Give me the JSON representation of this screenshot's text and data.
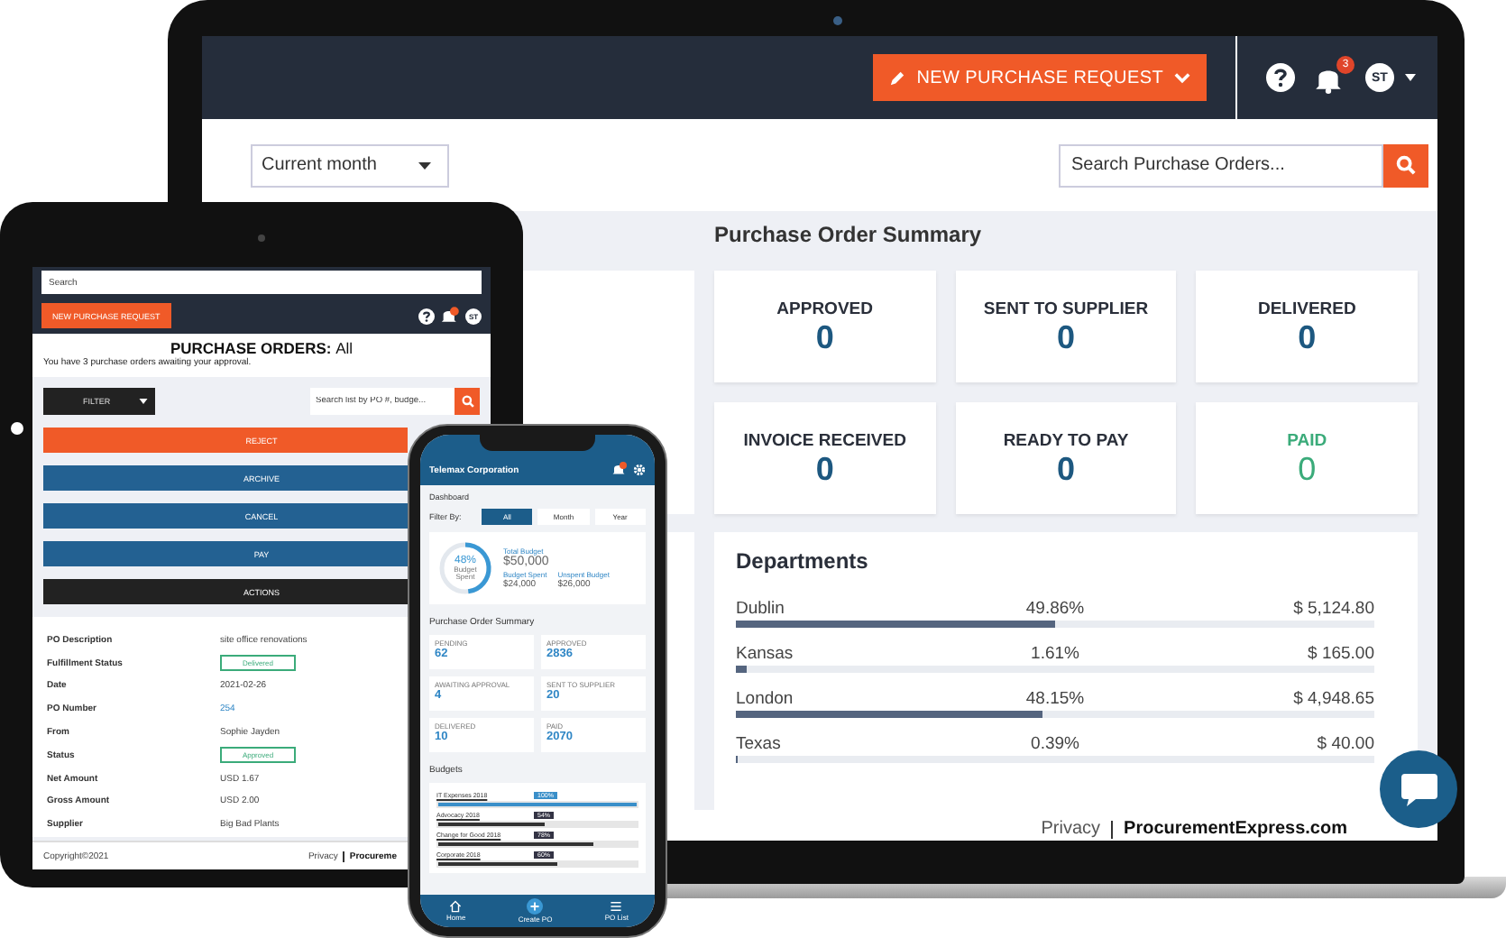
{
  "laptop": {
    "header": {
      "new_request_button": "NEW PURCHASE REQUEST",
      "notification_count": "3",
      "avatar": "ST"
    },
    "period_select": "Current month",
    "search": {
      "placeholder": "Search Purchase Orders..."
    },
    "summary": {
      "title": "Purchase Order Summary",
      "cards": [
        {
          "label": "APPROVED",
          "value": "0",
          "kind": "normal"
        },
        {
          "label": "SENT TO SUPPLIER",
          "value": "0",
          "kind": "normal"
        },
        {
          "label": "DELIVERED",
          "value": "0",
          "kind": "normal"
        },
        {
          "label": "INVOICE RECEIVED",
          "value": "0",
          "kind": "normal"
        },
        {
          "label": "READY TO PAY",
          "value": "0",
          "kind": "normal"
        },
        {
          "label": "PAID",
          "value": "0",
          "kind": "paid"
        }
      ]
    },
    "departments": {
      "title": "Departments",
      "rows": [
        {
          "name": "Dublin",
          "percent": "49.86%",
          "amount": "$ 5,124.80",
          "level": 0.4986
        },
        {
          "name": "Kansas",
          "percent": "1.61%",
          "amount": "$ 165.00",
          "level": 0.0161
        },
        {
          "name": "London",
          "percent": "48.15%",
          "amount": "$ 4,948.65",
          "level": 0.4815
        },
        {
          "name": "Texas",
          "percent": "0.39%",
          "amount": "$ 40.00",
          "level": 0.0039
        }
      ]
    },
    "footer": {
      "privacy": "Privacy",
      "brand": "ProcurementExpress.com"
    }
  },
  "tablet": {
    "search": {
      "placeholder": "Search"
    },
    "new_request_button": "NEW PURCHASE REQUEST",
    "avatar": "ST",
    "title": "PURCHASE ORDERS:",
    "filter_value": "All",
    "subtitle": "You have 3 purchase orders awaiting your approval.",
    "filter_select": "FILTER",
    "list_search": {
      "placeholder": "Search list by PO #, budge..."
    },
    "actions": [
      {
        "label": "REJECT",
        "kind": "danger"
      },
      {
        "label": "ARCHIVE",
        "kind": "primary"
      },
      {
        "label": "CANCEL",
        "kind": "primary"
      },
      {
        "label": "PAY",
        "kind": "primary"
      },
      {
        "label": "ACTIONS",
        "kind": "dark"
      }
    ],
    "details": [
      {
        "label": "PO Description",
        "value": "site office renovations",
        "kind": "text"
      },
      {
        "label": "Fulfillment Status",
        "value": "Delivered",
        "kind": "badge"
      },
      {
        "label": "Date",
        "value": "2021-02-26",
        "kind": "text"
      },
      {
        "label": "PO Number",
        "value": "254",
        "kind": "link"
      },
      {
        "label": "From",
        "value": "Sophie Jayden",
        "kind": "text"
      },
      {
        "label": "Status",
        "value": "Approved",
        "kind": "badge"
      },
      {
        "label": "Net Amount",
        "value": "USD 1.67",
        "kind": "text"
      },
      {
        "label": "Gross Amount",
        "value": "USD 2.00",
        "kind": "text"
      },
      {
        "label": "Supplier",
        "value": "Big Bad Plants",
        "kind": "text"
      }
    ],
    "footer": {
      "copyright": "Copyright©2021",
      "privacy": "Privacy",
      "brand": "Procureme"
    }
  },
  "phone": {
    "company": "Telemax Corporation",
    "page": "Dashboard",
    "filter_label": "Filter By:",
    "filters": [
      {
        "label": "All",
        "selected": true
      },
      {
        "label": "Month",
        "selected": false
      },
      {
        "label": "Year",
        "selected": false
      }
    ],
    "budget": {
      "percent": "48%",
      "percent_label": "Budget Spent",
      "level": 0.48,
      "total_label": "Total Budget",
      "total": "$50,000",
      "spent_label": "Budget Spent",
      "spent": "$24,000",
      "unspent_label": "Unspent Budget",
      "unspent": "$26,000"
    },
    "summary_title": "Purchase Order Summary",
    "summary": [
      {
        "label": "PENDING",
        "value": "62"
      },
      {
        "label": "APPROVED",
        "value": "2836"
      },
      {
        "label": "AWAITING APPROVAL",
        "value": "4"
      },
      {
        "label": "SENT TO SUPPLIER",
        "value": "20"
      },
      {
        "label": "DELIVERED",
        "value": "10"
      },
      {
        "label": "PAID",
        "value": "2070"
      }
    ],
    "budgets_title": "Budgets",
    "budgets": [
      {
        "name": "IT Expenses 2018",
        "percent": "100%",
        "level": 1.0,
        "kind": "full"
      },
      {
        "name": "Advocacy 2018",
        "percent": "54%",
        "level": 0.54,
        "kind": "normal"
      },
      {
        "name": "Change for Good 2018",
        "percent": "78%",
        "level": 0.78,
        "kind": "normal"
      },
      {
        "name": "Corporate 2018",
        "percent": "60%",
        "level": 0.6,
        "kind": "normal"
      }
    ],
    "nav": [
      {
        "label": "Home",
        "kind": "home"
      },
      {
        "label": "Create PO",
        "kind": "create"
      },
      {
        "label": "PO List",
        "kind": "list"
      }
    ]
  }
}
